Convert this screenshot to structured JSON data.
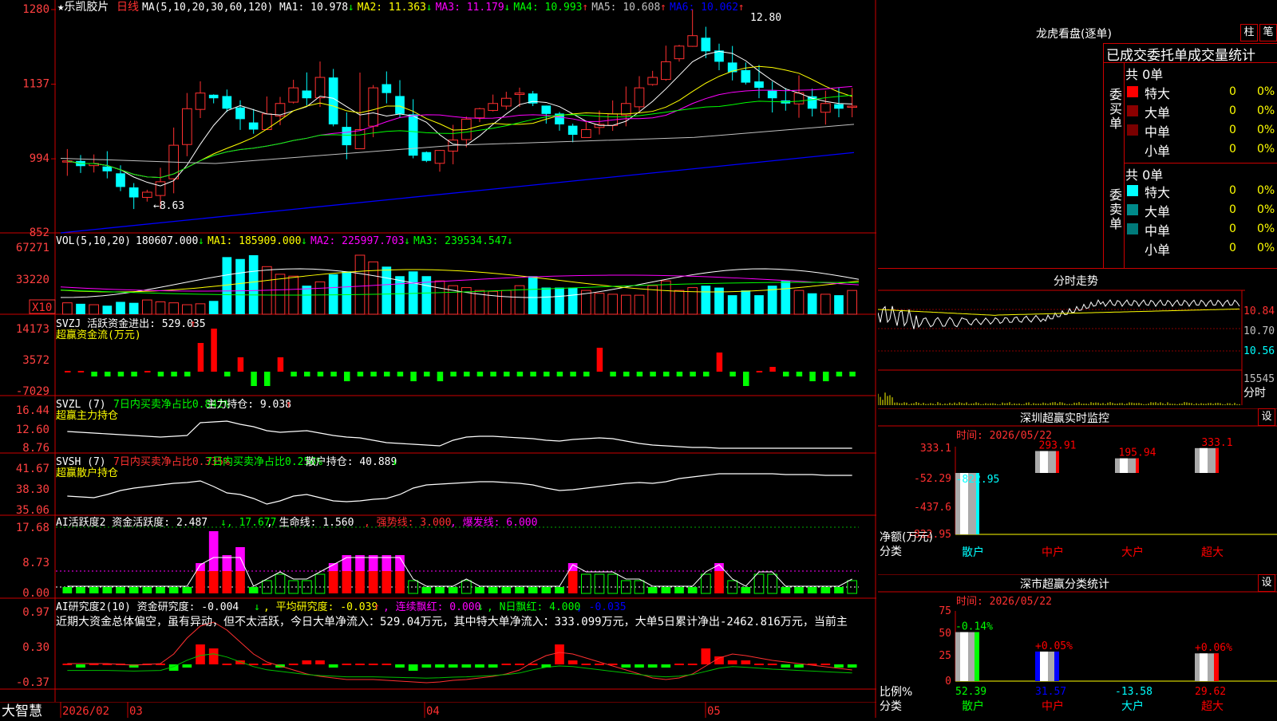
{
  "stock": {
    "name": "★乐凯胶片",
    "period": "日线"
  },
  "ma_panel": {
    "spec": "MA(5,10,20,30,60,120)",
    "items": [
      {
        "label": "MA1: 10.978",
        "arrow": "↓",
        "color": "#ffffff"
      },
      {
        "label": "MA2: 11.363",
        "arrow": "↓",
        "color": "#ffff00"
      },
      {
        "label": "MA3: 11.179",
        "arrow": "↓",
        "color": "#ff00ff"
      },
      {
        "label": "MA4: 10.993",
        "arrow": "↑",
        "color": "#00ff00"
      },
      {
        "label": "MA5: 10.608",
        "arrow": "↑",
        "color": "#c0c0c0"
      },
      {
        "label": "MA6: 10.062",
        "arrow": "↑",
        "color": "#0000ff"
      }
    ],
    "y_ticks": [
      "1280",
      "1137",
      "994",
      "852"
    ],
    "high_label": "12.80",
    "low_label": "←8.63"
  },
  "vol_panel": {
    "spec": "VOL(5,10,20)",
    "items": [
      {
        "label": "180607.000",
        "arrow": "↓",
        "color": "#ffffff"
      },
      {
        "label": "MA1: 185909.000",
        "arrow": "↓",
        "color": "#ffff00"
      },
      {
        "label": "MA2: 225997.703",
        "arrow": "↓",
        "color": "#ff00ff"
      },
      {
        "label": "MA3: 239534.547",
        "arrow": "↓",
        "color": "#00ff00"
      }
    ],
    "y_ticks": [
      "67271",
      "33220"
    ],
    "unit": "X10"
  },
  "svzj_panel": {
    "title": "SVZJ  活跃资金进出: 529.035",
    "arrow": "↑",
    "subtitle": "超赢资金流(万元)",
    "y_ticks": [
      "14173",
      "3572",
      "-7029"
    ]
  },
  "svzl_panel": {
    "title_a": "SVZL (7) ",
    "title_b": "7日内买卖净占比0.842%",
    "title_c": " 主力持仓: 9.038",
    "arrow": "↑",
    "subtitle": "超赢主力持仓",
    "y_ticks": [
      "16.44",
      "12.60",
      "8.76"
    ]
  },
  "svsh_panel": {
    "title_a": "SVSH (7) ",
    "title_b": "7日内买卖净占比0.335%",
    "title_c": " 7日内买卖净占比0.256%",
    "title_d": " 散户持仓: 40.889",
    "arrow": "↓",
    "subtitle": "超赢散户持仓",
    "y_ticks": [
      "41.67",
      "38.30",
      "35.06"
    ]
  },
  "ai_active_panel": {
    "title_a": "AI活跃度2 资金活跃度: 2.487",
    "title_b": "↓, 17.677",
    "title_c": ", 生命线: 1.560",
    "title_d": ", 强势线: 3.000",
    "title_e": ", 爆发线: 6.000",
    "y_ticks": [
      "17.68",
      "8.73",
      "0.00"
    ]
  },
  "ai_research_panel": {
    "title_a": "AI研究度2(10) 资金研究度: -0.004",
    "title_b": ", 平均研究度: -0.039",
    "title_c": ", 连续飘红: 0.000",
    "title_d": ", N日飘红: 4.000",
    "title_e": ", -0.035",
    "commentary": "近期大资金总体偏空，虽有异动，但不太活跃，今日大单净流入：529.04万元，其中特大单净流入：333.099万元，大单5日累计净出-2462.816万元，当前主",
    "y_ticks": [
      "0.97",
      "0.30",
      "-0.37"
    ]
  },
  "statusbar": {
    "app": "大智慧",
    "dates": [
      "2026/02",
      "03",
      "04",
      "05"
    ]
  },
  "dragon_tiger": {
    "title": "龙虎看盘(逐单)",
    "btn_col": "柱",
    "btn_pen": "笔",
    "stats_title": "已成交委托单成交量统计",
    "buy_side": "委买单",
    "sell_side": "委卖单",
    "buy_total": "共 0单",
    "sell_total": "共 0单",
    "buy_rows": [
      {
        "label": "特大",
        "val": "0",
        "pct": "0%",
        "color": "#ff0000"
      },
      {
        "label": "大单",
        "val": "0",
        "pct": "0%",
        "color": "#8b0000"
      },
      {
        "label": "中单",
        "val": "0",
        "pct": "0%",
        "color": "#7a0000"
      },
      {
        "label": "小单",
        "val": "0",
        "pct": "0%",
        "color": "#000000"
      }
    ],
    "sell_rows": [
      {
        "label": "特大",
        "val": "0",
        "pct": "0%",
        "color": "#00ffff"
      },
      {
        "label": "大单",
        "val": "0",
        "pct": "0%",
        "color": "#008b8b"
      },
      {
        "label": "中单",
        "val": "0",
        "pct": "0%",
        "color": "#007a7a"
      },
      {
        "label": "小单",
        "val": "0",
        "pct": "0%",
        "color": "#000000"
      }
    ]
  },
  "intraday": {
    "title": "分时走势",
    "y_ticks": [
      "10.84",
      "10.70",
      "10.56"
    ],
    "vol_label": "15545",
    "time_label": "分时"
  },
  "sz_monitor": {
    "title": "深圳超赢实时监控",
    "btn": "设",
    "time": "时间: 2026/05/22",
    "y_ticks": [
      "333.1",
      "-52.29",
      "-437.6",
      "-822.95"
    ],
    "net_label": "净额(万元)",
    "class_label": "分类",
    "bars": [
      {
        "cat": "散户",
        "value": -822.95,
        "label": "-822.95",
        "color": "#00ffff"
      },
      {
        "cat": "中户",
        "value": 293.91,
        "label": "293.91",
        "color": "#ff0000"
      },
      {
        "cat": "大户",
        "value": 195.94,
        "label": "195.94",
        "color": "#ff0000"
      },
      {
        "cat": "超大",
        "value": 333.1,
        "label": "333.1",
        "color": "#ff0000"
      }
    ],
    "cat_colors": [
      "#00ffff",
      "#ff0000",
      "#ff0000",
      "#ff0000"
    ]
  },
  "sh_stats": {
    "title": "深市超赢分类统计",
    "btn": "设",
    "time": "时间: 2026/05/22",
    "y_ticks": [
      "75",
      "50",
      "25",
      "0"
    ],
    "ratio_label": "比例%",
    "class_label": "分类",
    "bars": [
      {
        "cat": "散户",
        "value": 52.39,
        "top": "-0.14%",
        "bottom": "52.39",
        "fill": "#00ff00",
        "topcolor": "#00ff00",
        "botcolor": "#00ff00"
      },
      {
        "cat": "中户",
        "value": 31.57,
        "top": "+0.05%",
        "bottom": "31.57",
        "fill": "#0000ff",
        "topcolor": "#ff0000",
        "botcolor": "#0000ff"
      },
      {
        "cat": "大户",
        "value": -13.58,
        "top": "",
        "bottom": "-13.58",
        "fill": "#00ffff",
        "topcolor": "#00ffff",
        "botcolor": "#00ffff"
      },
      {
        "cat": "超大",
        "value": 29.62,
        "top": "+0.06%",
        "bottom": "29.62",
        "fill": "#ff0000",
        "topcolor": "#ff0000",
        "botcolor": "#ff0000"
      }
    ],
    "cat_colors": [
      "#00ff00",
      "#ff0000",
      "#00ffff",
      "#ff0000"
    ]
  },
  "chart_data": [
    {
      "type": "line",
      "title": "★乐凯胶片 日线",
      "ylim": [
        8.52,
        12.8
      ],
      "series": [
        {
          "name": "MA1",
          "values": [
            9.55,
            9.5,
            9.4,
            9.3,
            9.1,
            9.0,
            9.1,
            9.4,
            9.9,
            10.4,
            10.8,
            11.1,
            11.2,
            11.1,
            11.0,
            10.9,
            10.8,
            10.9,
            11.0,
            11.1,
            11.0,
            10.8,
            10.6,
            10.3,
            10.0,
            10.1,
            10.3,
            10.6,
            10.8,
            11.1,
            11.2,
            11.1,
            11.0,
            10.8,
            10.6,
            10.5,
            10.7,
            11.2,
            11.7,
            12.1,
            12.2,
            12.0,
            11.7,
            11.5,
            11.3,
            11.1,
            11.0
          ]
        },
        {
          "name": "MA2",
          "values": [
            9.7,
            9.65,
            9.6,
            9.5,
            9.4,
            9.3,
            9.3,
            9.4,
            9.6,
            9.9,
            10.2,
            10.5,
            10.7,
            10.8,
            10.9,
            10.9,
            10.9,
            10.9,
            11.0,
            11.0,
            10.9,
            10.8,
            10.6,
            10.5,
            10.4,
            10.3,
            10.3,
            10.4,
            10.5,
            10.6,
            10.8,
            10.9,
            10.9,
            10.9,
            10.8,
            10.7,
            10.7,
            10.8,
            11.0,
            11.3,
            11.5,
            11.6,
            11.6,
            11.5,
            11.4,
            11.4,
            11.36
          ]
        }
      ]
    },
    {
      "type": "bar",
      "title": "VOL(5,10,20)",
      "values": [
        12,
        11,
        10,
        9,
        13,
        12,
        15,
        13,
        12,
        10,
        11,
        14,
        60,
        58,
        62,
        50,
        42,
        40,
        30,
        34,
        42,
        45,
        62,
        55,
        50,
        40,
        45,
        40,
        35,
        30,
        28,
        25,
        24,
        25,
        30,
        40,
        28,
        28,
        28,
        25,
        22,
        21,
        20,
        20,
        30,
        35,
        25,
        28,
        30,
        28,
        20,
        25,
        20,
        30,
        35,
        25,
        22,
        21,
        20,
        25,
        20,
        28,
        22,
        25,
        28,
        20,
        25,
        15
      ],
      "ylim": [
        0,
        67271
      ]
    }
  ]
}
